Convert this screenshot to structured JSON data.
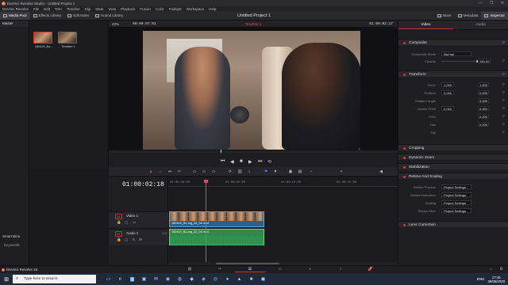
{
  "window": {
    "title": "DaVinci Resolve Studio - Untitled Project 1",
    "controls": [
      "—",
      "❐",
      "✕"
    ]
  },
  "menu": [
    "DaVinci Resolve",
    "File",
    "Edit",
    "Trim",
    "Timeline",
    "Clip",
    "Mark",
    "View",
    "Playback",
    "Fusion",
    "Color",
    "Fairlight",
    "Workspace",
    "Help"
  ],
  "toolbar": {
    "left": [
      "Media Pool",
      "Effects Library",
      "Edit Index",
      "Sound Library"
    ],
    "project_title": "Untitled Project 1",
    "right": [
      "Mixer",
      "Metadata",
      "Inspector"
    ]
  },
  "leftpanel": {
    "header": "Master",
    "smart_bins": "Smart Bins",
    "keywords": "Keywords"
  },
  "mediapool": {
    "clips": [
      "180419_Bo...",
      "Timeline 1"
    ]
  },
  "viewer": {
    "zoom": "43%",
    "timecode_in": "00:00:07:01",
    "timeline_name": "Timeline 1",
    "timecode_out": "01:00:02:17"
  },
  "transport": {
    "prev": "⏮",
    "back": "◀",
    "stop": "■",
    "play": "▶",
    "next": "⏭",
    "loop": "⟲"
  },
  "timeline": {
    "current_tc": "01:00:02:18",
    "ruler": [
      "01:00:00:00",
      "01:00:05:00",
      "01:00:10:00",
      "01:00:15:00"
    ],
    "video_track": {
      "tag": "V1",
      "name": "Video 1"
    },
    "audio_track": {
      "tag": "A1",
      "name": "Audio 1",
      "channels": "2.0"
    },
    "video_clip": "180419_Bo-mg_32_04.mp4",
    "audio_clip": "180419_Bo-mg_32_04.mp4"
  },
  "inspector": {
    "tabs": [
      "Video",
      "Audio"
    ],
    "composite": {
      "title": "Composite",
      "mode_label": "Composite Mode",
      "mode": "Normal",
      "opacity_label": "Opacity",
      "opacity": "100.00"
    },
    "transform": {
      "title": "Transform",
      "rows": [
        {
          "label": "Zoom",
          "x": "1.000",
          "y": "1.000"
        },
        {
          "label": "Position",
          "x": "0.000",
          "y": "0.000"
        },
        {
          "label": "Rotation Angle",
          "x": "0.000"
        },
        {
          "label": "Anchor Point",
          "x": "0.000",
          "y": "0.000"
        },
        {
          "label": "Pitch",
          "x": "0.000"
        },
        {
          "label": "Yaw",
          "x": "0.000"
        },
        {
          "label": "Flip",
          "x": ""
        }
      ]
    },
    "sections": [
      "Cropping",
      "Dynamic Zoom",
      "Stabilization"
    ],
    "retime": {
      "title": "Retime And Scaling",
      "rows": [
        {
          "label": "Retime Process",
          "value": "Project Settings"
        },
        {
          "label": "Motion Estimation",
          "value": "Project Settings"
        },
        {
          "label": "Scaling",
          "value": "Project Settings"
        },
        {
          "label": "Resize Filter",
          "value": "Project Settings"
        }
      ]
    },
    "lens": "Lens Correction"
  },
  "statusbar": {
    "app": "DaVinci Resolve 16"
  },
  "taskbar": {
    "search": "Type here to search",
    "lang": "ENG",
    "time": "17:45",
    "date": "29/06/2020"
  }
}
